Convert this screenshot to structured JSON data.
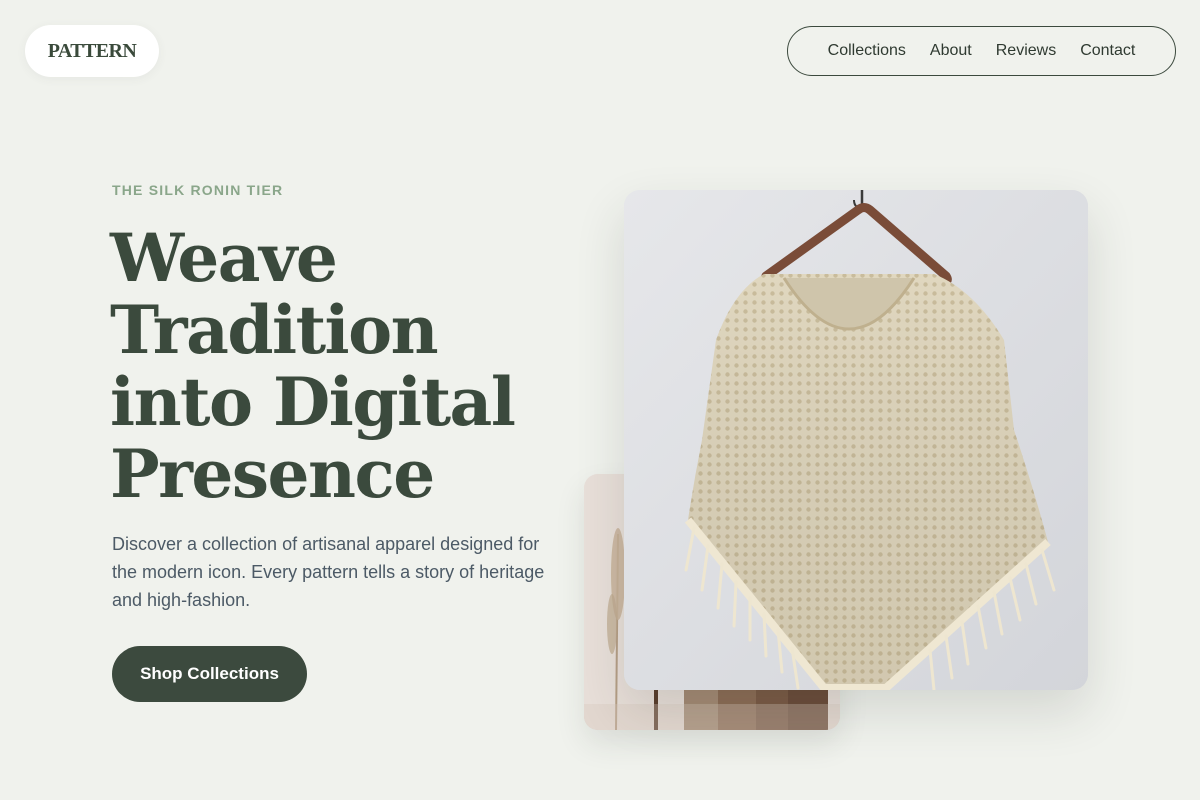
{
  "header": {
    "logo": "PATTERN",
    "nav": [
      "Collections",
      "About",
      "Reviews",
      "Contact"
    ]
  },
  "hero": {
    "eyebrow": "THE SILK RONIN TIER",
    "headline": [
      "Weave",
      "Tradition",
      "into Digital",
      "Presence"
    ],
    "description": "Discover a collection of artisanal apparel designed for the modern icon. Every pattern tells a story of heritage and high-fashion.",
    "cta_label": "Shop Collections"
  },
  "colors": {
    "background": "#f0f2ed",
    "primary": "#3c4a3e",
    "accent": "#8aa68a",
    "body_text": "#4c5a66"
  }
}
